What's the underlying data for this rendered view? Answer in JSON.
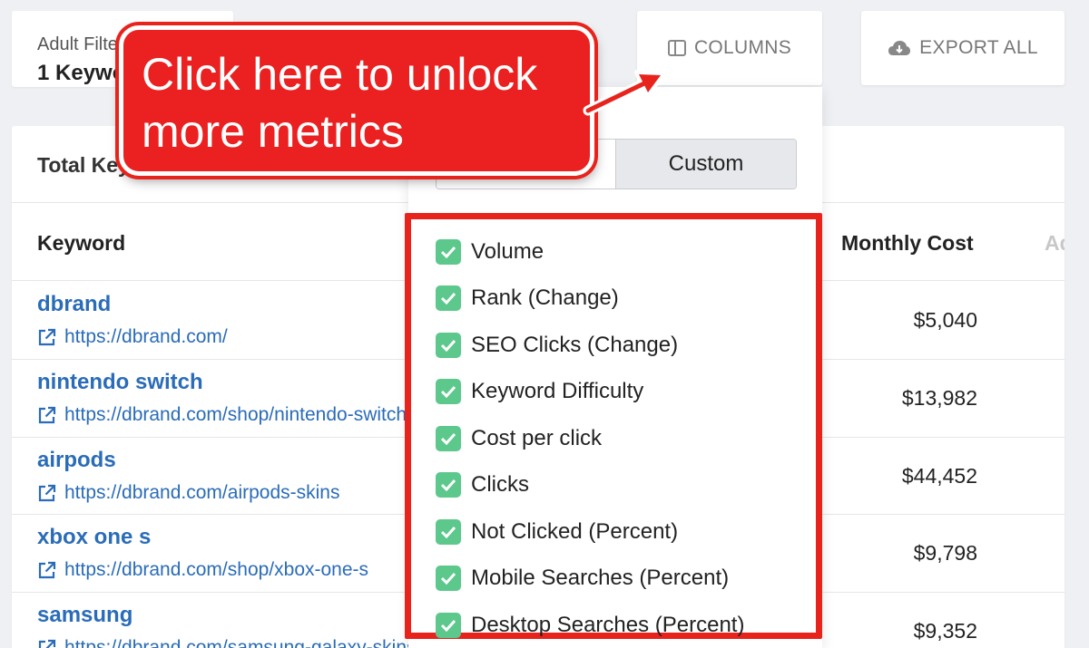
{
  "filter": {
    "label": "Adult Filter",
    "value": "1 Keyword"
  },
  "toolbar": {
    "columns_label": "COLUMNS",
    "export_label": "EXPORT ALL"
  },
  "table": {
    "total_label": "Total Keywords",
    "headers": {
      "keyword": "Keyword",
      "monthly_cost": "Monthly Cost",
      "ad": "Ad"
    },
    "rows": [
      {
        "keyword": "dbrand",
        "url": "https://dbrand.com/",
        "cost": "$5,040"
      },
      {
        "keyword": "nintendo switch",
        "url": "https://dbrand.com/shop/nintendo-switch",
        "cost": "$13,982"
      },
      {
        "keyword": "airpods",
        "url": "https://dbrand.com/airpods-skins",
        "cost": "$44,452"
      },
      {
        "keyword": "xbox one s",
        "url": "https://dbrand.com/shop/xbox-one-s",
        "cost": "$9,798"
      },
      {
        "keyword": "samsung",
        "url": "https://dbrand.com/samsung-galaxy-skins",
        "cost": "$9,352"
      }
    ]
  },
  "columns_menu": {
    "segment_custom": "Custom",
    "metrics": [
      {
        "label": "Volume",
        "checked": true
      },
      {
        "label": "Rank (Change)",
        "checked": true
      },
      {
        "label": "SEO Clicks (Change)",
        "checked": true
      },
      {
        "label": "Keyword Difficulty",
        "checked": true
      },
      {
        "label": "Cost per click",
        "checked": true
      },
      {
        "label": "Clicks",
        "checked": true
      },
      {
        "label": "Not Clicked (Percent)",
        "checked": true
      },
      {
        "label": "Mobile Searches (Percent)",
        "checked": true
      },
      {
        "label": "Desktop Searches (Percent)",
        "checked": true
      }
    ]
  },
  "callout": {
    "line1": "Click here to unlock",
    "line2": "more metrics"
  },
  "colors": {
    "link": "#2a6cb8",
    "check": "#5cc88b",
    "highlight": "#e8231c"
  },
  "icons": {
    "columns": "columns-icon",
    "export": "cloud-download-icon",
    "external": "external-link-icon",
    "check": "check-icon"
  }
}
